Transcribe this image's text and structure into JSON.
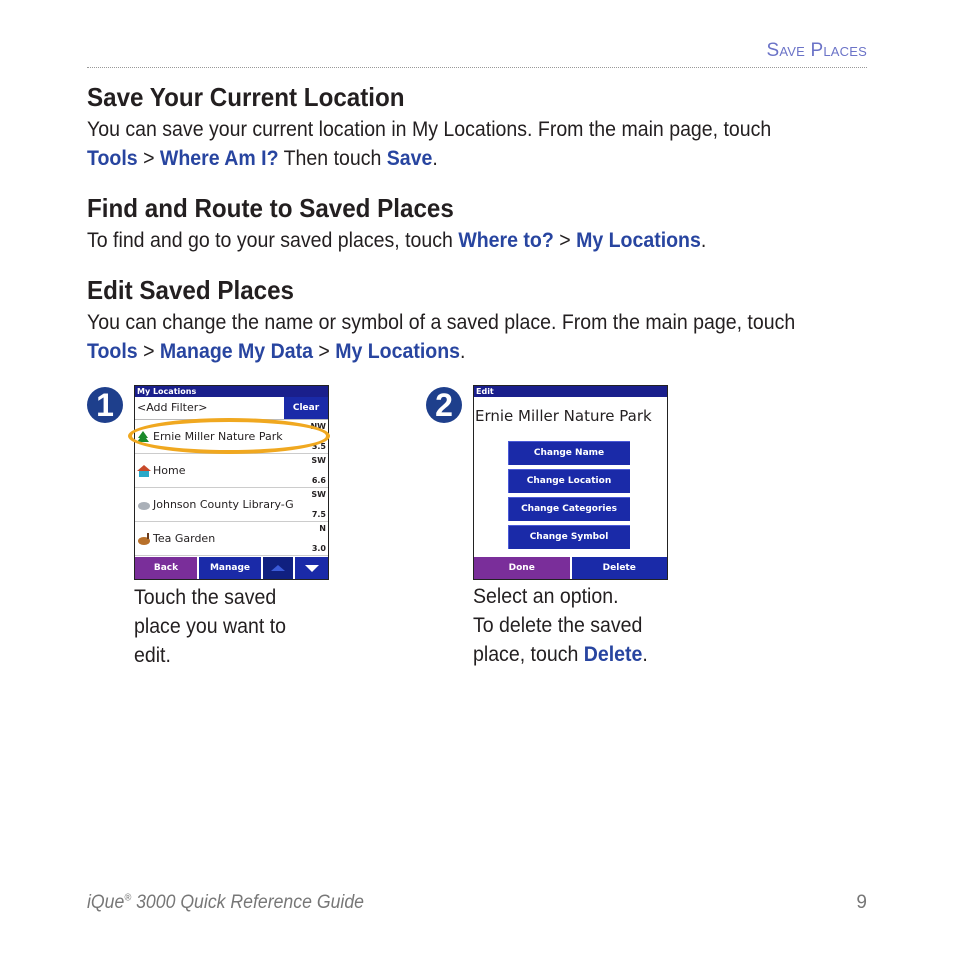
{
  "header": {
    "title": "Save Places"
  },
  "sections": [
    {
      "heading": "Save Your Current Location",
      "line1": "You can save your current location in My Locations. From the main page, touch",
      "line2": {
        "k1": "Tools",
        "sep1": " > ",
        "k2": "Where Am I?",
        "mid": " Then touch ",
        "k3": "Save",
        "end": "."
      }
    },
    {
      "heading": "Find and Route to Saved Places",
      "line1": {
        "pre": "To find and go to your saved places, touch ",
        "k1": "Where to?",
        "sep1": " > ",
        "k2": "My Locations",
        "end": "."
      }
    },
    {
      "heading": "Edit Saved Places",
      "line1": "You can change the name or symbol of a saved place. From the main page, touch",
      "line2": {
        "k1": "Tools",
        "sep1": " > ",
        "k2": "Manage My Data",
        "sep2": " > ",
        "k3": "My Locations",
        "end": "."
      }
    }
  ],
  "steps": [
    {
      "number": "1",
      "screen": {
        "title": "My Locations",
        "filter": "<Add Filter>",
        "clear": "Clear",
        "rows": [
          {
            "name": "Ernie Miller Nature Park",
            "dir": "NW",
            "dist": "3.5",
            "icon": "tree-icon"
          },
          {
            "name": "Home",
            "dir": "SW",
            "dist": "6.6",
            "icon": "house-icon"
          },
          {
            "name": "Johnson County Library-G",
            "dir": "SW",
            "dist": "7.5",
            "icon": "book-icon"
          },
          {
            "name": "Tea Garden",
            "dir": "N",
            "dist": "3.0",
            "icon": "teapot-icon"
          }
        ],
        "buttons": {
          "back": "Back",
          "manage": "Manage"
        }
      },
      "caption": [
        "Touch the saved",
        "place you want to",
        "edit."
      ]
    },
    {
      "number": "2",
      "screen": {
        "title": "Edit",
        "place": "Ernie Miller Nature Park",
        "options": [
          "Change Name",
          "Change Location",
          "Change Categories",
          "Change Symbol"
        ],
        "buttons": {
          "done": "Done",
          "delete": "Delete"
        }
      },
      "caption": {
        "l1": "Select an option.",
        "l2": "To delete the saved",
        "l3pre": "place, touch ",
        "l3k": "Delete",
        "l3end": "."
      }
    }
  ],
  "footer": {
    "guide_pre": "iQue",
    "reg": "®",
    "guide_post": " 3000 Quick Reference Guide",
    "page": "9"
  },
  "colors": {
    "keyword": "#2845a0",
    "highlight": "#f0a820",
    "screen_blue": "#1a2aa8",
    "screen_purple": "#7a2e9a"
  }
}
